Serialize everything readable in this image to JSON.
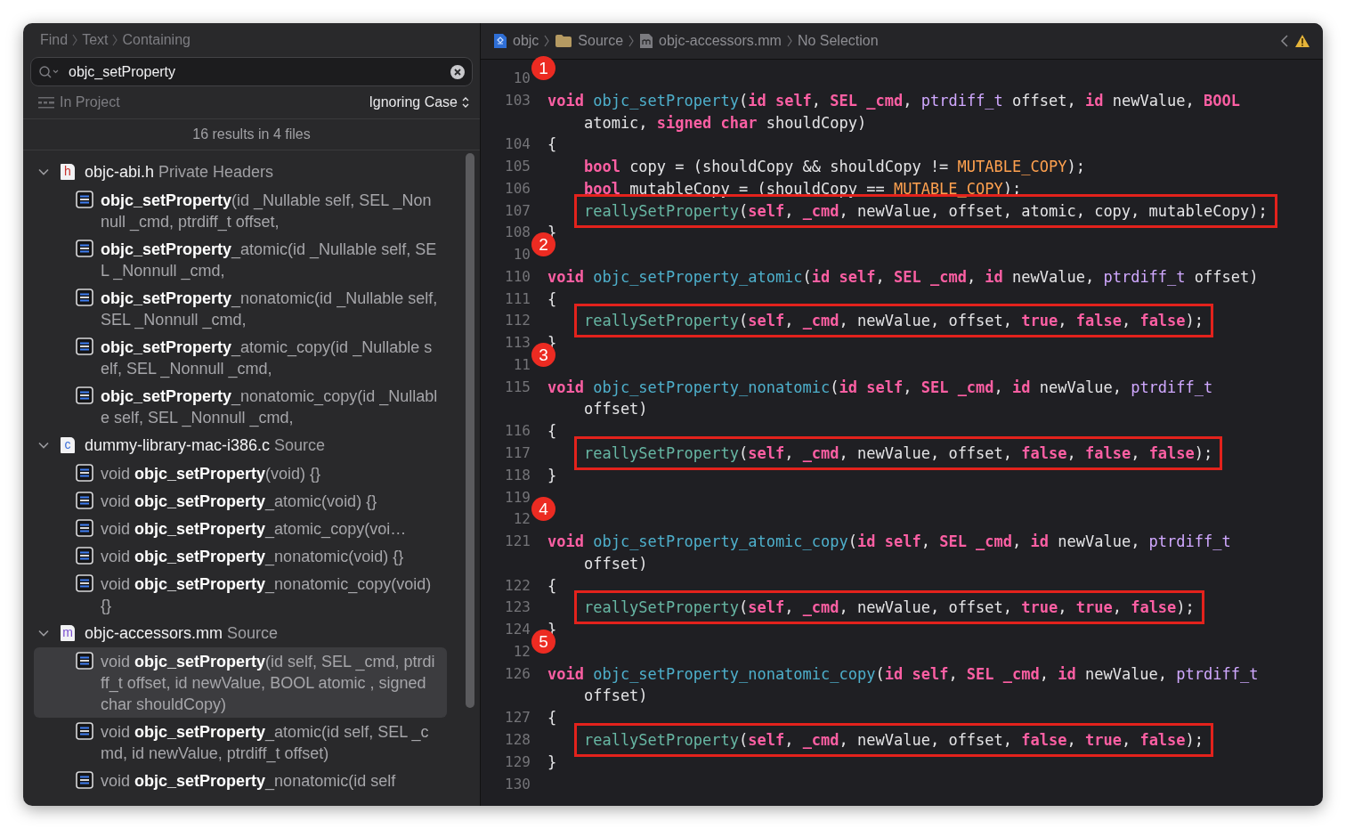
{
  "find_panel": {
    "breadcrumb": [
      "Find",
      "Text",
      "Containing"
    ],
    "search": {
      "value": "objc_setProperty"
    },
    "scope": "In Project",
    "case_option": "Ignoring Case",
    "summary": "16 results in 4 files",
    "groups": [
      {
        "file": "objc-abi.h",
        "location": "Private Headers",
        "icon_letter": "h",
        "color": "#c8322c",
        "expanded": true,
        "matches": [
          {
            "text": "**objc_setProperty**(id _Nullable self, SEL _Nonnull _cmd, ptrdiff_t offset,",
            "selected": false
          },
          {
            "text": "**objc_setProperty**_atomic(id _Nullable self, SEL _Nonnull _cmd,",
            "selected": false
          },
          {
            "text": "**objc_setProperty**_nonatomic(id _Nullable self, SEL _Nonnull _cmd,",
            "selected": false
          },
          {
            "text": "**objc_setProperty**_atomic_copy(id _Nullable self, SEL _Nonnull _cmd,",
            "selected": false
          },
          {
            "text": "**objc_setProperty**_nonatomic_copy(id _Nullable self, SEL _Nonnull _cmd,",
            "selected": false
          }
        ]
      },
      {
        "file": "dummy-library-mac-i386.c",
        "location": "Source",
        "icon_letter": "c",
        "color": "#3b6fd8",
        "expanded": true,
        "matches": [
          {
            "text": "void **objc_setProperty**(void) {}",
            "selected": false
          },
          {
            "text": "void **objc_setProperty**_atomic(void) {}",
            "selected": false
          },
          {
            "text": "void **objc_setProperty**_atomic_copy(voi…",
            "selected": false
          },
          {
            "text": "void **objc_setProperty**_nonatomic(void) {}",
            "selected": false
          },
          {
            "text": "void **objc_setProperty**_nonatomic_copy(void) {}",
            "selected": false
          }
        ]
      },
      {
        "file": "objc-accessors.mm",
        "location": "Source",
        "icon_letter": "m",
        "color": "#7a4fd0",
        "expanded": true,
        "matches": [
          {
            "text": "void **objc_setProperty**(id self, SEL _cmd, ptrdiff_t offset, id newValue, BOOL atomic , signed char shouldCopy)",
            "selected": true
          },
          {
            "text": "void **objc_setProperty**_atomic(id self, SEL _cmd, id newValue, ptrdiff_t offset)",
            "selected": false
          },
          {
            "text": "void **objc_setProperty**_nonatomic(id self",
            "selected": false
          }
        ]
      }
    ]
  },
  "editor": {
    "breadcrumb": [
      {
        "kind": "project",
        "label": "objc"
      },
      {
        "kind": "folder",
        "label": "Source"
      },
      {
        "kind": "file",
        "label": "objc-accessors.mm"
      },
      {
        "kind": "none",
        "label": "No Selection"
      }
    ],
    "lines": [
      {
        "number": "10",
        "badge": "1"
      },
      {
        "number": "103",
        "kind": "top",
        "highlighted": false,
        "tokens": [
          {
            "kind": "keyword",
            "text": "void "
          },
          {
            "kind": "function",
            "text": "objc_setProperty"
          },
          {
            "kind": "plain",
            "text": "("
          },
          {
            "kind": "keyword",
            "text": "id self"
          },
          {
            "kind": "plain",
            "text": ", "
          },
          {
            "kind": "keyword",
            "text": "SEL _cmd"
          },
          {
            "kind": "plain",
            "text": ", "
          },
          {
            "kind": "type",
            "text": "ptrdiff_t"
          },
          {
            "kind": "plain",
            "text": " offset, "
          },
          {
            "kind": "keyword",
            "text": "id"
          },
          {
            "kind": "plain",
            "text": " newValue, "
          },
          {
            "kind": "keyword",
            "text": "BOOL"
          }
        ]
      },
      {
        "kind": "wrap",
        "highlighted": false,
        "tokens": [
          {
            "kind": "plain",
            "text": "atomic, "
          },
          {
            "kind": "keyword",
            "text": "signed char"
          },
          {
            "kind": "plain",
            "text": " shouldCopy)"
          }
        ]
      },
      {
        "number": "104",
        "kind": "top",
        "highlighted": false,
        "tokens": [
          {
            "kind": "plain",
            "text": "{"
          }
        ]
      },
      {
        "number": "105",
        "kind": "body",
        "highlighted": false,
        "tokens": [
          {
            "kind": "keyword",
            "text": "bool"
          },
          {
            "kind": "plain",
            "text": " copy = (shouldCopy && shouldCopy != "
          },
          {
            "kind": "macro",
            "text": "MUTABLE_COPY"
          },
          {
            "kind": "plain",
            "text": ");"
          }
        ]
      },
      {
        "number": "106",
        "kind": "body",
        "highlighted": false,
        "tokens": [
          {
            "kind": "keyword",
            "text": "bool"
          },
          {
            "kind": "plain",
            "text": " mutableCopy = (shouldCopy == "
          },
          {
            "kind": "macro",
            "text": "MUTABLE_COPY"
          },
          {
            "kind": "plain",
            "text": ");"
          }
        ]
      },
      {
        "number": "107",
        "kind": "body",
        "highlighted": true,
        "tokens": [
          {
            "kind": "call",
            "text": "reallySetProperty"
          },
          {
            "kind": "plain",
            "text": "("
          },
          {
            "kind": "keyword",
            "text": "self"
          },
          {
            "kind": "plain",
            "text": ", "
          },
          {
            "kind": "keyword",
            "text": "_cmd"
          },
          {
            "kind": "plain",
            "text": ", newValue, offset, atomic, copy, mutableCopy);"
          }
        ]
      },
      {
        "number": "108",
        "kind": "top",
        "highlighted": false,
        "tokens": [
          {
            "kind": "plain",
            "text": "}"
          }
        ]
      },
      {
        "number": "10",
        "badge": "2"
      },
      {
        "number": "110",
        "kind": "top",
        "highlighted": false,
        "tokens": [
          {
            "kind": "keyword",
            "text": "void "
          },
          {
            "kind": "function",
            "text": "objc_setProperty_atomic"
          },
          {
            "kind": "plain",
            "text": "("
          },
          {
            "kind": "keyword",
            "text": "id self"
          },
          {
            "kind": "plain",
            "text": ", "
          },
          {
            "kind": "keyword",
            "text": "SEL _cmd"
          },
          {
            "kind": "plain",
            "text": ", "
          },
          {
            "kind": "keyword",
            "text": "id"
          },
          {
            "kind": "plain",
            "text": " newValue, "
          },
          {
            "kind": "type",
            "text": "ptrdiff_t"
          },
          {
            "kind": "plain",
            "text": " offset)"
          }
        ]
      },
      {
        "number": "111",
        "kind": "top",
        "highlighted": false,
        "tokens": [
          {
            "kind": "plain",
            "text": "{"
          }
        ]
      },
      {
        "number": "112",
        "kind": "body",
        "highlighted": true,
        "tokens": [
          {
            "kind": "call",
            "text": "reallySetProperty"
          },
          {
            "kind": "plain",
            "text": "("
          },
          {
            "kind": "keyword",
            "text": "self"
          },
          {
            "kind": "plain",
            "text": ", "
          },
          {
            "kind": "keyword",
            "text": "_cmd"
          },
          {
            "kind": "plain",
            "text": ", newValue, offset, "
          },
          {
            "kind": "keyword",
            "text": "true"
          },
          {
            "kind": "plain",
            "text": ", "
          },
          {
            "kind": "keyword",
            "text": "false"
          },
          {
            "kind": "plain",
            "text": ", "
          },
          {
            "kind": "keyword",
            "text": "false"
          },
          {
            "kind": "plain",
            "text": ");"
          }
        ]
      },
      {
        "number": "113",
        "kind": "top",
        "highlighted": false,
        "tokens": [
          {
            "kind": "plain",
            "text": "}"
          }
        ]
      },
      {
        "number": "11",
        "badge": "3"
      },
      {
        "number": "115",
        "kind": "top",
        "highlighted": false,
        "tokens": [
          {
            "kind": "keyword",
            "text": "void "
          },
          {
            "kind": "function",
            "text": "objc_setProperty_nonatomic"
          },
          {
            "kind": "plain",
            "text": "("
          },
          {
            "kind": "keyword",
            "text": "id self"
          },
          {
            "kind": "plain",
            "text": ", "
          },
          {
            "kind": "keyword",
            "text": "SEL _cmd"
          },
          {
            "kind": "plain",
            "text": ", "
          },
          {
            "kind": "keyword",
            "text": "id"
          },
          {
            "kind": "plain",
            "text": " newValue, "
          },
          {
            "kind": "type",
            "text": "ptrdiff_t"
          }
        ]
      },
      {
        "kind": "wrap",
        "highlighted": false,
        "tokens": [
          {
            "kind": "plain",
            "text": "offset)"
          }
        ]
      },
      {
        "number": "116",
        "kind": "top",
        "highlighted": false,
        "tokens": [
          {
            "kind": "plain",
            "text": "{"
          }
        ]
      },
      {
        "number": "117",
        "kind": "body",
        "highlighted": true,
        "tokens": [
          {
            "kind": "call",
            "text": "reallySetProperty"
          },
          {
            "kind": "plain",
            "text": "("
          },
          {
            "kind": "keyword",
            "text": "self"
          },
          {
            "kind": "plain",
            "text": ", "
          },
          {
            "kind": "keyword",
            "text": "_cmd"
          },
          {
            "kind": "plain",
            "text": ", newValue, offset, "
          },
          {
            "kind": "keyword",
            "text": "false"
          },
          {
            "kind": "plain",
            "text": ", "
          },
          {
            "kind": "keyword",
            "text": "false"
          },
          {
            "kind": "plain",
            "text": ", "
          },
          {
            "kind": "keyword",
            "text": "false"
          },
          {
            "kind": "plain",
            "text": ");"
          }
        ]
      },
      {
        "number": "118",
        "kind": "top",
        "highlighted": false,
        "tokens": [
          {
            "kind": "plain",
            "text": "}"
          }
        ]
      },
      {
        "number": "119"
      },
      {
        "number": "12",
        "badge": "4"
      },
      {
        "number": "121",
        "kind": "top",
        "highlighted": false,
        "tokens": [
          {
            "kind": "keyword",
            "text": "void "
          },
          {
            "kind": "function",
            "text": "objc_setProperty_atomic_copy"
          },
          {
            "kind": "plain",
            "text": "("
          },
          {
            "kind": "keyword",
            "text": "id self"
          },
          {
            "kind": "plain",
            "text": ", "
          },
          {
            "kind": "keyword",
            "text": "SEL _cmd"
          },
          {
            "kind": "plain",
            "text": ", "
          },
          {
            "kind": "keyword",
            "text": "id"
          },
          {
            "kind": "plain",
            "text": " newValue, "
          },
          {
            "kind": "type",
            "text": "ptrdiff_t"
          }
        ]
      },
      {
        "kind": "wrap",
        "highlighted": false,
        "tokens": [
          {
            "kind": "plain",
            "text": "offset)"
          }
        ]
      },
      {
        "number": "122",
        "kind": "top",
        "highlighted": false,
        "tokens": [
          {
            "kind": "plain",
            "text": "{"
          }
        ]
      },
      {
        "number": "123",
        "kind": "body",
        "highlighted": true,
        "tokens": [
          {
            "kind": "call",
            "text": "reallySetProperty"
          },
          {
            "kind": "plain",
            "text": "("
          },
          {
            "kind": "keyword",
            "text": "self"
          },
          {
            "kind": "plain",
            "text": ", "
          },
          {
            "kind": "keyword",
            "text": "_cmd"
          },
          {
            "kind": "plain",
            "text": ", newValue, offset, "
          },
          {
            "kind": "keyword",
            "text": "true"
          },
          {
            "kind": "plain",
            "text": ", "
          },
          {
            "kind": "keyword",
            "text": "true"
          },
          {
            "kind": "plain",
            "text": ", "
          },
          {
            "kind": "keyword",
            "text": "false"
          },
          {
            "kind": "plain",
            "text": ");"
          }
        ]
      },
      {
        "number": "124",
        "kind": "top",
        "highlighted": false,
        "tokens": [
          {
            "kind": "plain",
            "text": "}"
          }
        ]
      },
      {
        "number": "12",
        "badge": "5"
      },
      {
        "number": "126",
        "kind": "top",
        "highlighted": false,
        "tokens": [
          {
            "kind": "keyword",
            "text": "void "
          },
          {
            "kind": "function",
            "text": "objc_setProperty_nonatomic_copy"
          },
          {
            "kind": "plain",
            "text": "("
          },
          {
            "kind": "keyword",
            "text": "id self"
          },
          {
            "kind": "plain",
            "text": ", "
          },
          {
            "kind": "keyword",
            "text": "SEL _cmd"
          },
          {
            "kind": "plain",
            "text": ", "
          },
          {
            "kind": "keyword",
            "text": "id"
          },
          {
            "kind": "plain",
            "text": " newValue, "
          },
          {
            "kind": "type",
            "text": "ptrdiff_t"
          }
        ]
      },
      {
        "kind": "wrap",
        "highlighted": false,
        "tokens": [
          {
            "kind": "plain",
            "text": "offset)"
          }
        ]
      },
      {
        "number": "127",
        "kind": "top",
        "highlighted": false,
        "tokens": [
          {
            "kind": "plain",
            "text": "{"
          }
        ]
      },
      {
        "number": "128",
        "kind": "body",
        "highlighted": true,
        "tokens": [
          {
            "kind": "call",
            "text": "reallySetProperty"
          },
          {
            "kind": "plain",
            "text": "("
          },
          {
            "kind": "keyword",
            "text": "self"
          },
          {
            "kind": "plain",
            "text": ", "
          },
          {
            "kind": "keyword",
            "text": "_cmd"
          },
          {
            "kind": "plain",
            "text": ", newValue, offset, "
          },
          {
            "kind": "keyword",
            "text": "false"
          },
          {
            "kind": "plain",
            "text": ", "
          },
          {
            "kind": "keyword",
            "text": "true"
          },
          {
            "kind": "plain",
            "text": ", "
          },
          {
            "kind": "keyword",
            "text": "false"
          },
          {
            "kind": "plain",
            "text": ");"
          }
        ]
      },
      {
        "number": "129",
        "kind": "top",
        "highlighted": false,
        "tokens": [
          {
            "kind": "plain",
            "text": "}"
          }
        ]
      },
      {
        "number": "130"
      }
    ]
  }
}
